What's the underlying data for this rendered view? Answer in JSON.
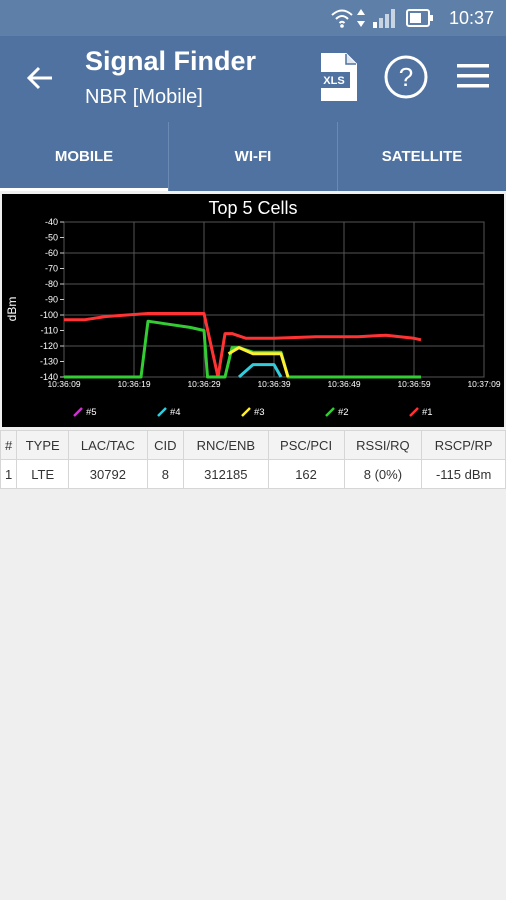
{
  "status": {
    "time": "10:37"
  },
  "app": {
    "title": "Signal Finder",
    "subtitle": "NBR [Mobile]"
  },
  "icons": {
    "back": "arrow-left-icon",
    "export": "xls-icon",
    "help": "help-circle-icon",
    "menu": "hamburger-menu-icon",
    "export_label": "XLS",
    "help_label": "?"
  },
  "tabs": [
    {
      "label": "MOBILE",
      "active": true
    },
    {
      "label": "WI-FI",
      "active": false
    },
    {
      "label": "SATELLITE",
      "active": false
    }
  ],
  "colors": {
    "appbar": "#4f72a0",
    "series_1": "#ff3333",
    "series_2": "#33cc33",
    "series_3": "#ffee33",
    "series_4": "#33ccdd",
    "series_5": "#cc33cc"
  },
  "chart_data": {
    "type": "line",
    "title": "Top 5 Cells",
    "ylabel": "dBm",
    "xlabel": "",
    "ylim": [
      -140,
      -40
    ],
    "yticks": [
      "-40",
      "-50",
      "-60",
      "-70",
      "-80",
      "-90",
      "-100",
      "-110",
      "-120",
      "-130",
      "-140"
    ],
    "xticks": [
      "10:36:09",
      "10:36:19",
      "10:36:29",
      "10:36:39",
      "10:36:49",
      "10:36:59",
      "10:37:09"
    ],
    "legend_position": "bottom",
    "grid": true,
    "series": [
      {
        "name": "#1",
        "color": "#ff3333",
        "x": [
          "10:36:09",
          "10:36:12",
          "10:36:15",
          "10:36:18",
          "10:36:21",
          "10:36:24",
          "10:36:27",
          "10:36:29",
          "10:36:31",
          "10:36:32",
          "10:36:33",
          "10:36:35",
          "10:36:39",
          "10:36:45",
          "10:36:51",
          "10:36:55",
          "10:36:57",
          "10:36:59",
          "10:37:00"
        ],
        "y": [
          -103,
          -103,
          -101,
          -100,
          -99,
          -99,
          -99,
          -99,
          -140,
          -112,
          -112,
          -115,
          -115,
          -114,
          -114,
          -113,
          -114,
          -115,
          -116
        ]
      },
      {
        "name": "#2",
        "color": "#33cc33",
        "x": [
          "10:36:09",
          "10:36:20",
          "10:36:21",
          "10:36:24",
          "10:36:27",
          "10:36:29",
          "10:36:29.5",
          "10:36:32",
          "10:36:33",
          "10:36:34",
          "10:36:36",
          "10:36:40",
          "10:36:41",
          "10:37:00"
        ],
        "y": [
          -140,
          -140,
          -104,
          -106,
          -108,
          -110,
          -140,
          -140,
          -121,
          -121,
          -124,
          -124,
          -140,
          -140
        ]
      },
      {
        "name": "#3",
        "color": "#ffee33",
        "x": [
          "10:36:32.5",
          "10:36:34",
          "10:36:36",
          "10:36:40",
          "10:36:41"
        ],
        "y": [
          -125,
          -121,
          -125,
          -125,
          -140
        ]
      },
      {
        "name": "#4",
        "color": "#33ccdd",
        "x": [
          "10:36:34",
          "10:36:36",
          "10:36:39",
          "10:36:40"
        ],
        "y": [
          -140,
          -132,
          -132,
          -140
        ]
      },
      {
        "name": "#5",
        "color": "#cc33cc",
        "x": [],
        "y": []
      }
    ],
    "legend": [
      "#5",
      "#4",
      "#3",
      "#2",
      "#1"
    ]
  },
  "table": {
    "headers": [
      "#",
      "TYPE",
      "LAC/TAC",
      "CID",
      "RNC/ENB",
      "PSC/PCI",
      "RSSI/RQ",
      "RSCP/RP"
    ],
    "rows": [
      [
        "1",
        "LTE",
        "30792",
        "8",
        "312185",
        "162",
        "8 (0%)",
        "-115 dBm"
      ]
    ]
  }
}
